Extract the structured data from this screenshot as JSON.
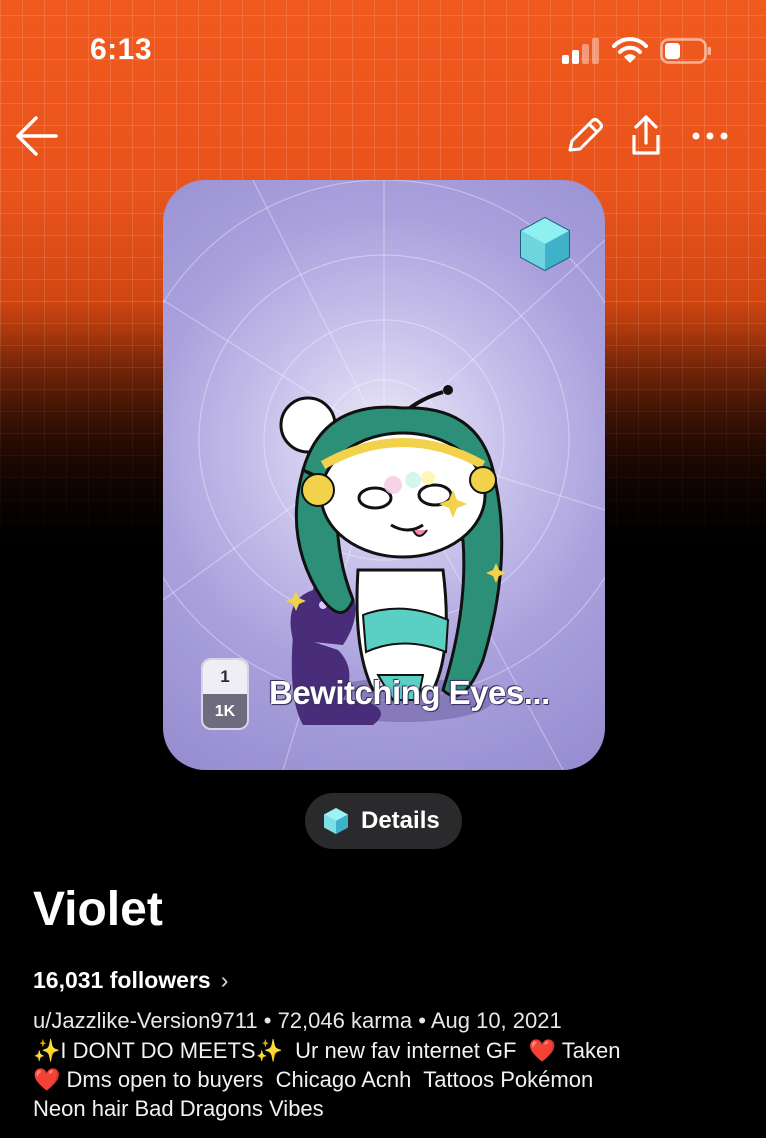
{
  "status_bar": {
    "time": "6:13"
  },
  "nav": {
    "icons": [
      "arrow-left-icon",
      "pencil-icon",
      "share-icon",
      "more-icon"
    ]
  },
  "nft": {
    "name": "Bewitching Eyes...",
    "edition_number": "1",
    "edition_total": "1K",
    "background_color": "#958cd0"
  },
  "details_button": {
    "label": "Details"
  },
  "profile": {
    "name": "Violet",
    "followers": "16,031 followers",
    "username": "u/Jazzlike-Version9711",
    "karma": "72,046 karma",
    "cake_day": "Aug 10, 2021",
    "separator": "•",
    "bio_lines": [
      "✨I DONT DO MEETS✨  Ur new fav internet GF  ❤️ Taken",
      "❤️ Dms open to buyers  Chicago Acnh  Tattoos Pokémon",
      "Neon hair Bad Dragons Vibes"
    ]
  },
  "colors": {
    "header_orange": "#f05a1e",
    "background": "#000000",
    "button_bg": "#2a2a2c"
  }
}
